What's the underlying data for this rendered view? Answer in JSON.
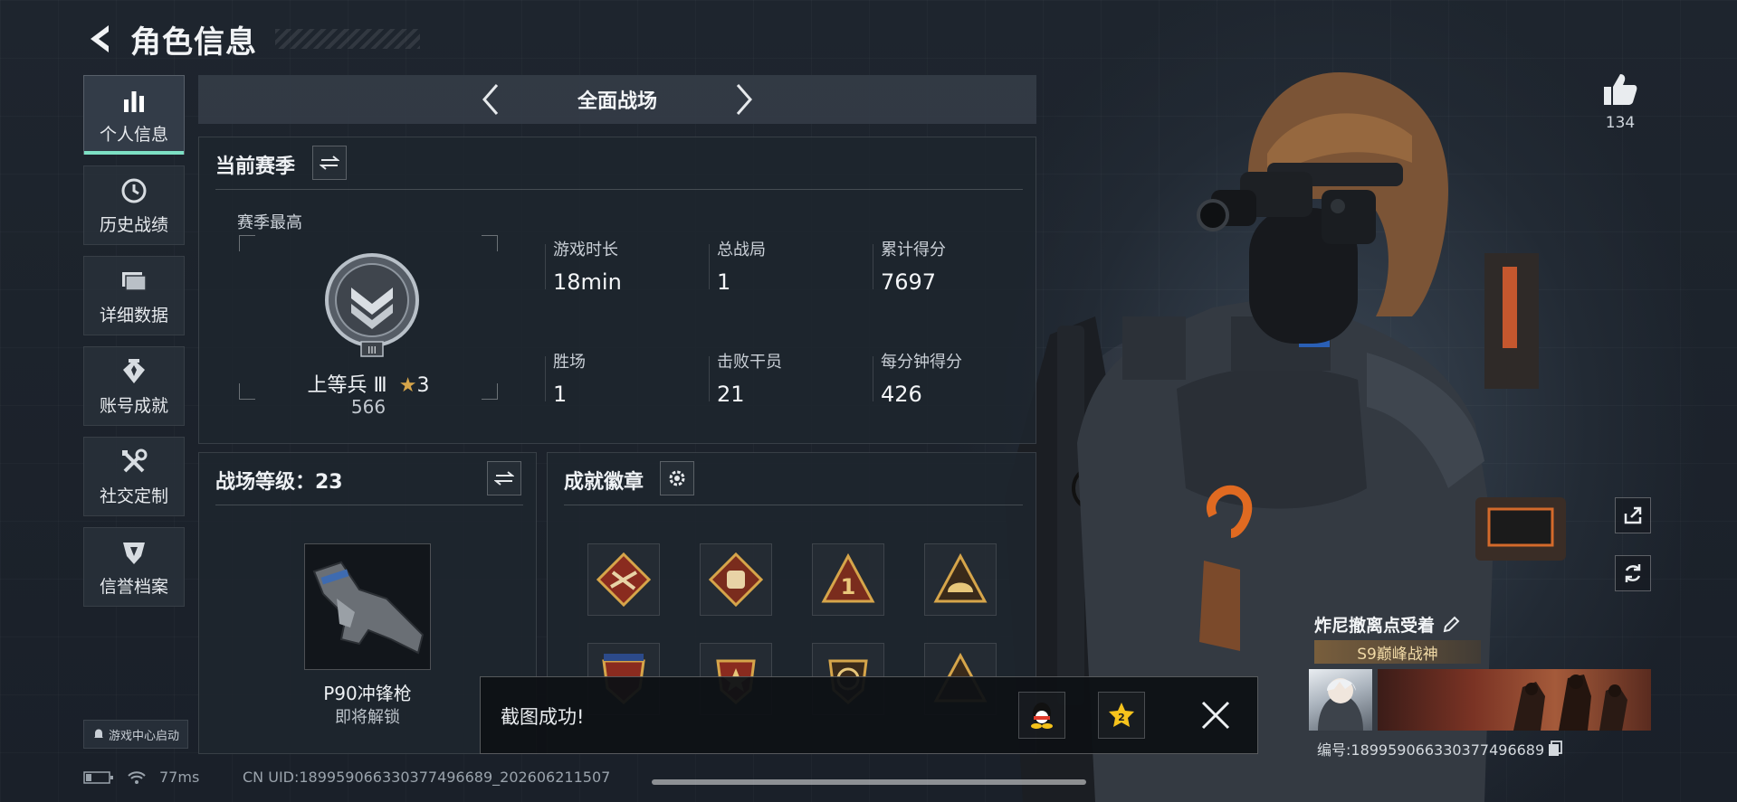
{
  "header": {
    "title": "角色信息"
  },
  "sidebar": {
    "items": [
      {
        "label": "个人信息",
        "icon": "bar-chart-icon",
        "active": true
      },
      {
        "label": "历史战绩",
        "icon": "clock-icon"
      },
      {
        "label": "详细数据",
        "icon": "folder-icon"
      },
      {
        "label": "账号成就",
        "icon": "achievement-icon"
      },
      {
        "label": "社交定制",
        "icon": "tools-icon"
      },
      {
        "label": "信誉档案",
        "icon": "shield-icon"
      }
    ],
    "launch_badge": "游戏中心启动"
  },
  "mode_selector": {
    "current": "全面战场"
  },
  "season": {
    "title": "当前赛季",
    "best_label": "赛季最高",
    "rank": {
      "name": "上等兵 Ⅲ",
      "stars": "3",
      "score": "566",
      "emblem_numeral": "III"
    },
    "stats": [
      {
        "label": "游戏时长",
        "value": "18min"
      },
      {
        "label": "总战局",
        "value": "1"
      },
      {
        "label": "累计得分",
        "value": "7697"
      },
      {
        "label": "胜场",
        "value": "1"
      },
      {
        "label": "击败干员",
        "value": "21"
      },
      {
        "label": "每分钟得分",
        "value": "426"
      }
    ]
  },
  "battlefield_level": {
    "title": "战场等级：23",
    "weapon_name": "P90冲锋枪",
    "weapon_status": "即将解锁"
  },
  "badges": {
    "title": "成就徽章"
  },
  "toast": {
    "message": "截图成功!"
  },
  "social": {
    "like_count": "134"
  },
  "player": {
    "name": "炸尼撤离点受着",
    "tag": "S9巅峰战神",
    "id": "编号:18995906633037749668​9"
  },
  "status": {
    "ping": "77ms",
    "uid": "CN UID:18995906633037749668​9_202606211507"
  },
  "colors": {
    "accent": "#7de0c4",
    "gold": "#d6a54a",
    "badge_red": "#8a2b1f"
  }
}
